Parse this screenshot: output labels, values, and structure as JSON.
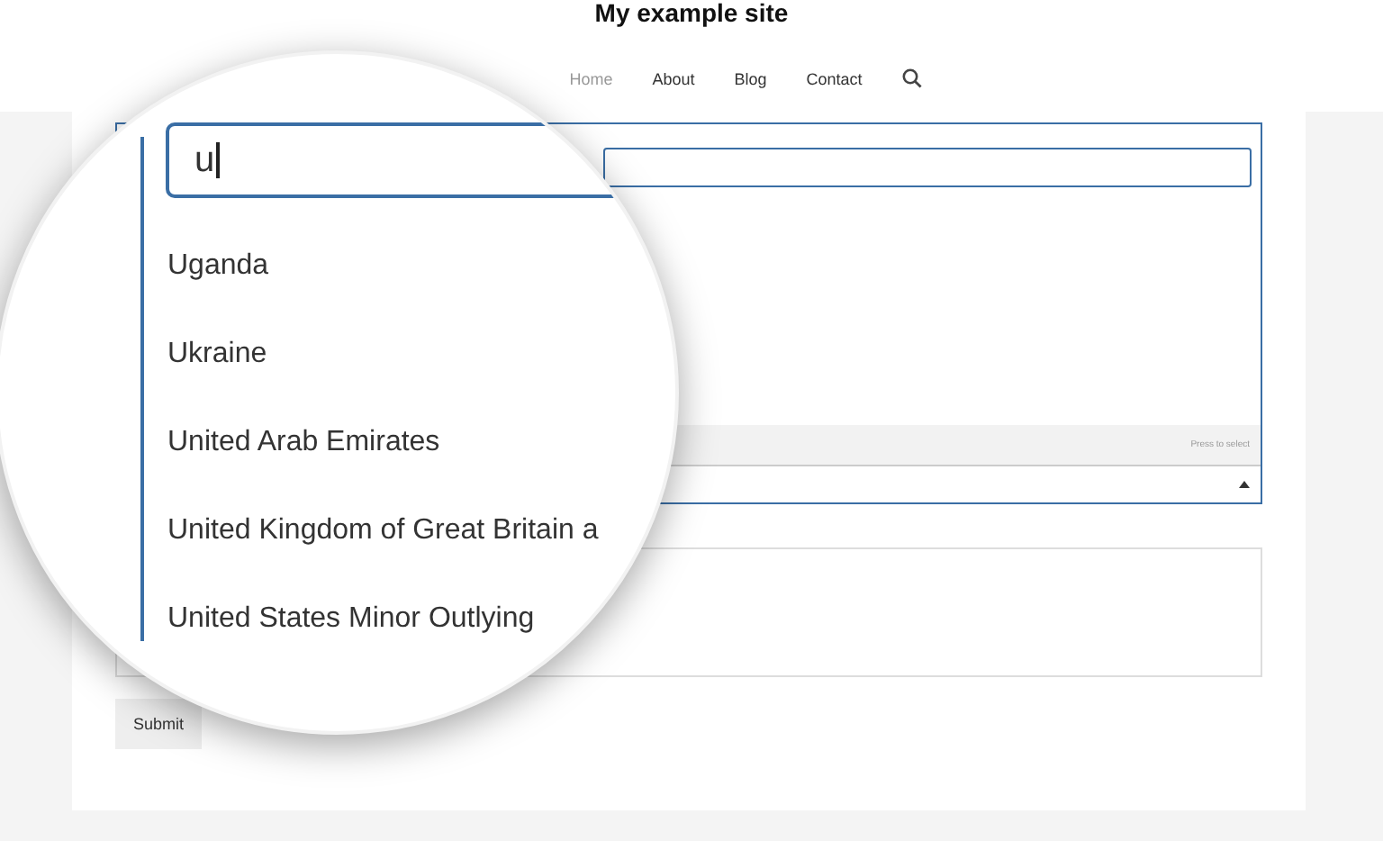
{
  "site_title": "My example site",
  "nav": [
    {
      "label": "Home",
      "selected": true
    },
    {
      "label": "About",
      "selected": false
    },
    {
      "label": "Blog",
      "selected": false
    },
    {
      "label": "Contact",
      "selected": false
    }
  ],
  "dropdown": {
    "expanded": true,
    "hint": "Press to select"
  },
  "magnifier": {
    "search_value": "u",
    "options": [
      "Uganda",
      "Ukraine",
      "United Arab Emirates",
      "United Kingdom of Great Britain a",
      "United States Minor Outlying"
    ]
  },
  "submit": "Submit"
}
